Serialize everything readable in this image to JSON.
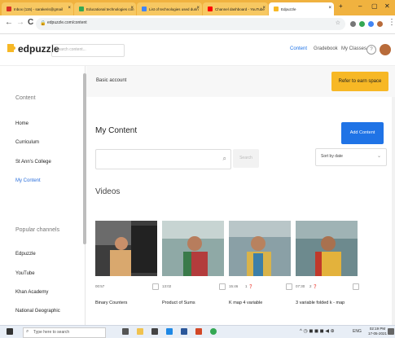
{
  "browser": {
    "tabs": [
      {
        "label": "Inbox (115) - sarakeris@gmail",
        "color": "#d93025"
      },
      {
        "label": "Educational technologies con",
        "color": "#34a853"
      },
      {
        "label": "List of technologies used durin",
        "color": "#4285f4"
      },
      {
        "label": "Channel dashboard - YouTube",
        "color": "#ff0000"
      },
      {
        "label": "Edpuzzle",
        "color": "#f7b825"
      }
    ],
    "tab_close": "×",
    "new_tab": "+",
    "window_controls": {
      "minimize": "–",
      "maximize": "▢",
      "close": "✕"
    },
    "url": "edpuzzle.com/content",
    "nav": {
      "back": "←",
      "forward": "→",
      "reload": "C"
    }
  },
  "header": {
    "brand": "edpuzzle",
    "search_placeholder": "Search content...",
    "links": {
      "content": "Content",
      "gradebook": "Gradebook",
      "my_classes": "My Classes"
    },
    "help": "?"
  },
  "banner": {
    "account": "Basic account",
    "earn_button": "Refer to earn space"
  },
  "sidebar": {
    "content_heading": "Content",
    "items": [
      "Home",
      "Curriculum",
      "St Ann's College",
      "My Content"
    ],
    "selected": "My Content",
    "channels_heading": "Popular channels",
    "channels": [
      "Edpuzzle",
      "YouTube",
      "Khan Academy",
      "National Geographic"
    ]
  },
  "main": {
    "title": "My Content",
    "add_button": "Add Content",
    "search_button": "Search",
    "sort_label": "Sort by date",
    "videos_heading": "Videos",
    "videos": [
      {
        "duration": "00:57",
        "questions": "",
        "title": "Binary Counters"
      },
      {
        "duration": "13:02",
        "questions": "",
        "title": "Product of Sums"
      },
      {
        "duration": "15:46",
        "questions": "1",
        "title": "K map 4 variable"
      },
      {
        "duration": "07:30",
        "questions": "2",
        "title": "3 variable folded k - map"
      }
    ]
  },
  "taskbar": {
    "search_placeholder": "Type here to search",
    "time": "02:19 PM",
    "date": "17-05-2021",
    "lang": "ENG"
  }
}
